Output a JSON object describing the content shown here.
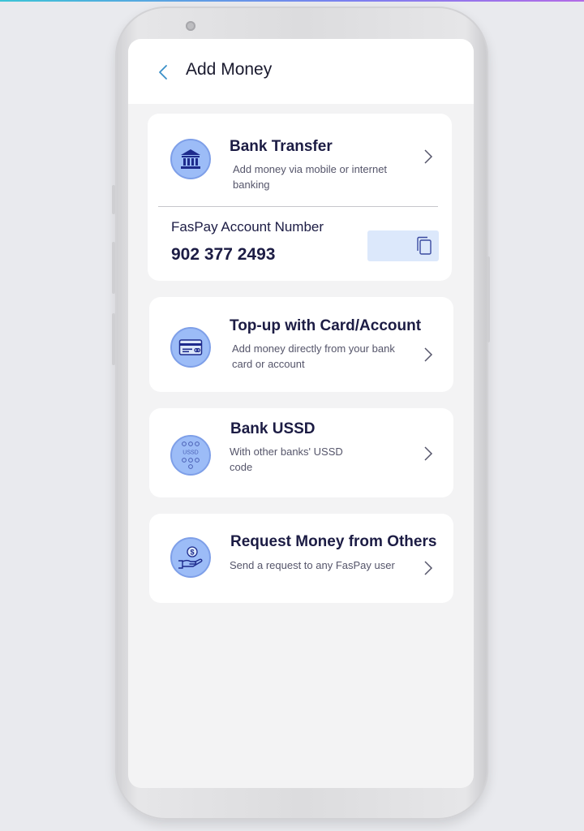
{
  "header": {
    "title": "Add Money"
  },
  "bank_transfer": {
    "title": "Bank Transfer",
    "description": "Add money via mobile or internet banking",
    "icon": "bank-icon",
    "account_label": "FasPay Account Number",
    "account_number": "902 377 2493"
  },
  "options": [
    {
      "title": "Top-up with Card/Account",
      "description": "Add money directly from your bank card or account",
      "icon": "credit-card-icon"
    },
    {
      "title": "Bank USSD",
      "description": "With other banks' USSD code",
      "icon": "ussd-keypad-icon",
      "icon_text": "USSD"
    },
    {
      "title": "Request Money from Others",
      "description": "Send a request to any FasPay user",
      "icon": "hand-money-icon"
    }
  ],
  "colors": {
    "accent": "#9cbcf7",
    "text_dark": "#1c1c44",
    "copy_button_bg": "#dce8fb",
    "back_arrow": "#3a8fc8"
  }
}
